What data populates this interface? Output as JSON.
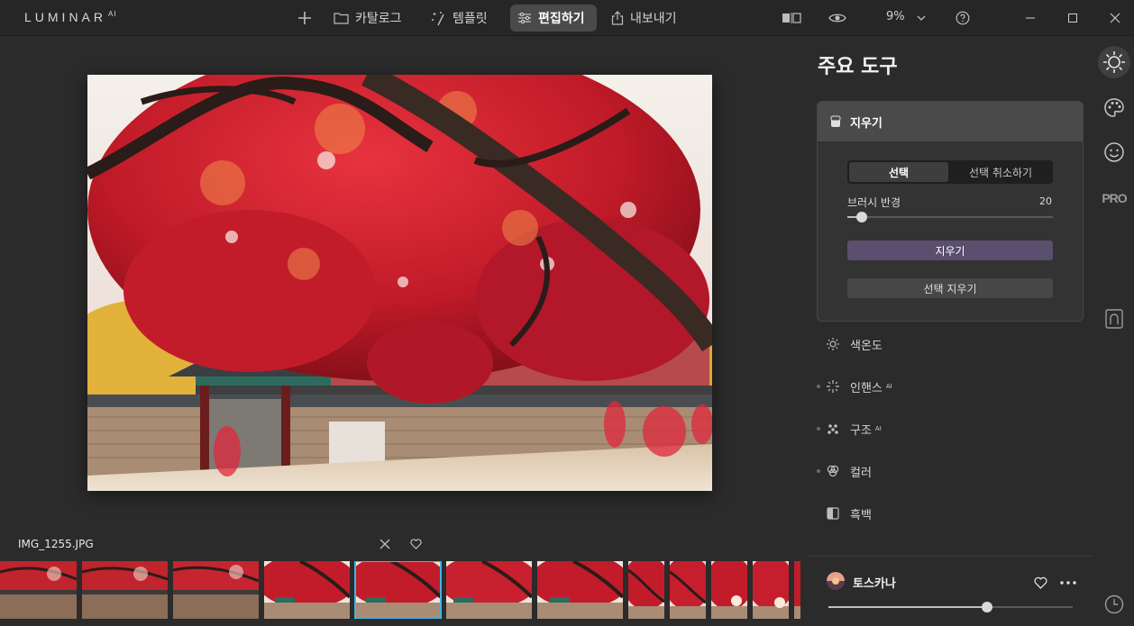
{
  "app": {
    "logo": "LUMINAR",
    "logo_suffix": "AI"
  },
  "toolbar": {
    "add_icon": "plus-icon",
    "catalog_label": "카탈로그",
    "templates_label": "템플릿",
    "edit_label": "편집하기",
    "export_label": "내보내기",
    "zoom": "9%"
  },
  "panel": {
    "title": "주요 도구",
    "erase": {
      "header": "지우기",
      "seg_select": "선택",
      "seg_deselect": "선택 취소하기",
      "brush_label": "브러시 반경",
      "brush_value": "20",
      "brush_fraction": 0.07,
      "erase_button": "지우기",
      "clear_button": "선택 지우기"
    },
    "tools": [
      {
        "label": "색온도",
        "ai": ""
      },
      {
        "label": "인핸스",
        "ai": "AI"
      },
      {
        "label": "구조",
        "ai": "AI"
      },
      {
        "label": "컬러",
        "ai": ""
      },
      {
        "label": "흑백",
        "ai": ""
      }
    ],
    "preset": {
      "name": "토스카나",
      "amount_fraction": 0.65
    }
  },
  "filmstrip": {
    "filename": "IMG_1255.JPG"
  },
  "colors": {
    "accent": "#3fb4e8",
    "erase_button": "#5a4f6e",
    "mask_overlay": "#e0283c"
  }
}
